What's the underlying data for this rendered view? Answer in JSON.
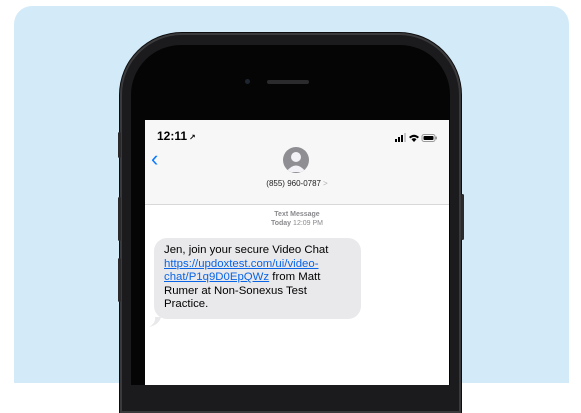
{
  "status_bar": {
    "time": "12:11"
  },
  "header": {
    "back_icon": "chevron-left-icon",
    "avatar_icon": "person-icon",
    "contact_number": "(855) 960-0787",
    "contact_chevron": ">"
  },
  "thread": {
    "message_type": "Text Message",
    "day": "Today",
    "time": "12:09 PM",
    "message": {
      "before_link": "Jen, join your secure Video Chat",
      "link": "https://updoxtest.com/ui/video-chat/P1q9D0EpQWz",
      "after_link": " from Matt Rumer at Non-Sonexus Test Practice."
    }
  },
  "colors": {
    "accent": "#0a7aff",
    "bubble": "#e9e9eb",
    "background": "#d3ebf9"
  }
}
